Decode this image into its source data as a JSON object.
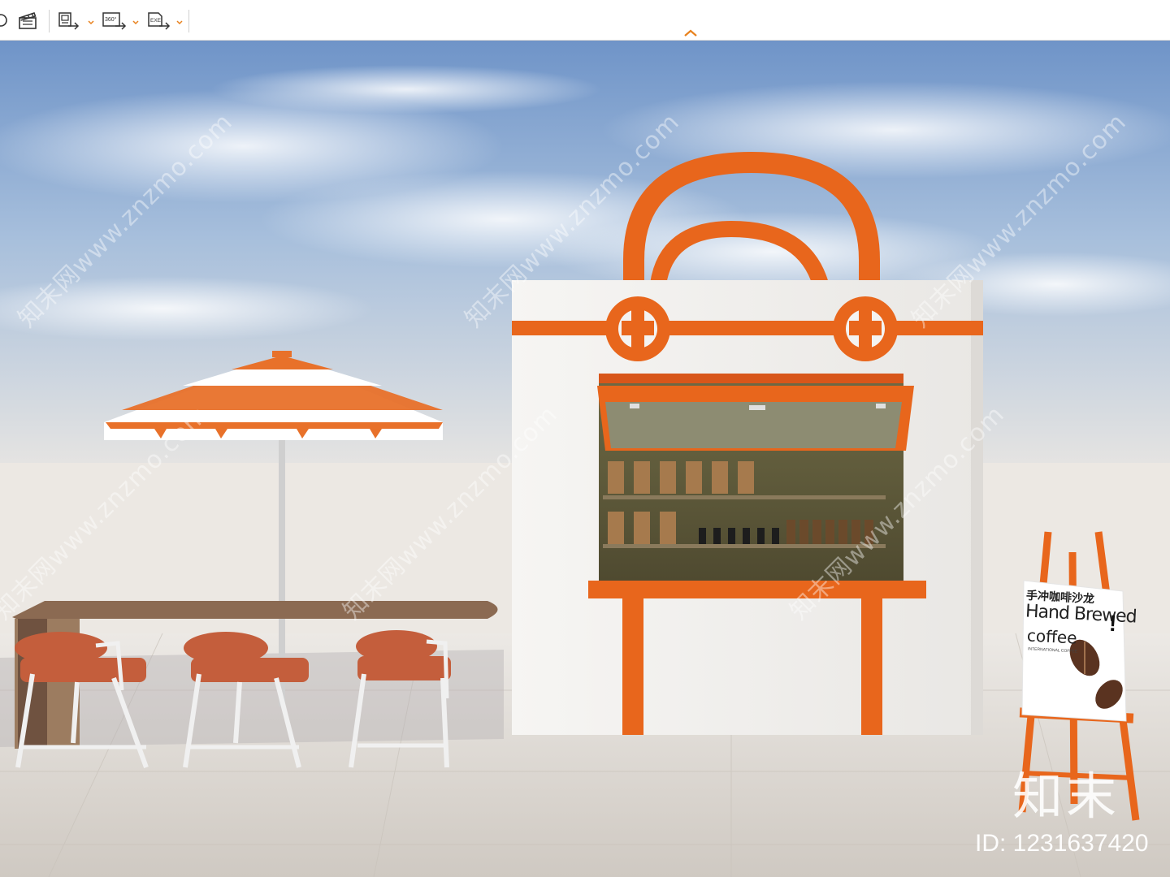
{
  "toolbar": {
    "buttons": [
      {
        "name": "animation",
        "icon": "clapperboard-icon"
      },
      {
        "name": "export-image",
        "icon": "export-image-icon"
      },
      {
        "name": "export-360",
        "icon": "export-360-icon",
        "label": "360°"
      },
      {
        "name": "export-exe",
        "icon": "export-exe-icon",
        "label": "EXE"
      }
    ],
    "collapse_icon": "chevron-up-icon",
    "accent": "#e8821e"
  },
  "watermark": {
    "text": "知末网www.znzmo.com",
    "brand": "知末",
    "id_text": "ID: 1231637420"
  },
  "sign": {
    "line_cn": "手冲咖啡沙龙",
    "line_en1": "Hand Brewed",
    "line_en2": "coffee",
    "small": "INTERNATIONAL COFFEE",
    "excl": "!"
  },
  "colors": {
    "orange": "#e8661c",
    "sky": "#8fb0d6",
    "wall": "#f2f1ef",
    "floor": "#d8d3cd"
  }
}
